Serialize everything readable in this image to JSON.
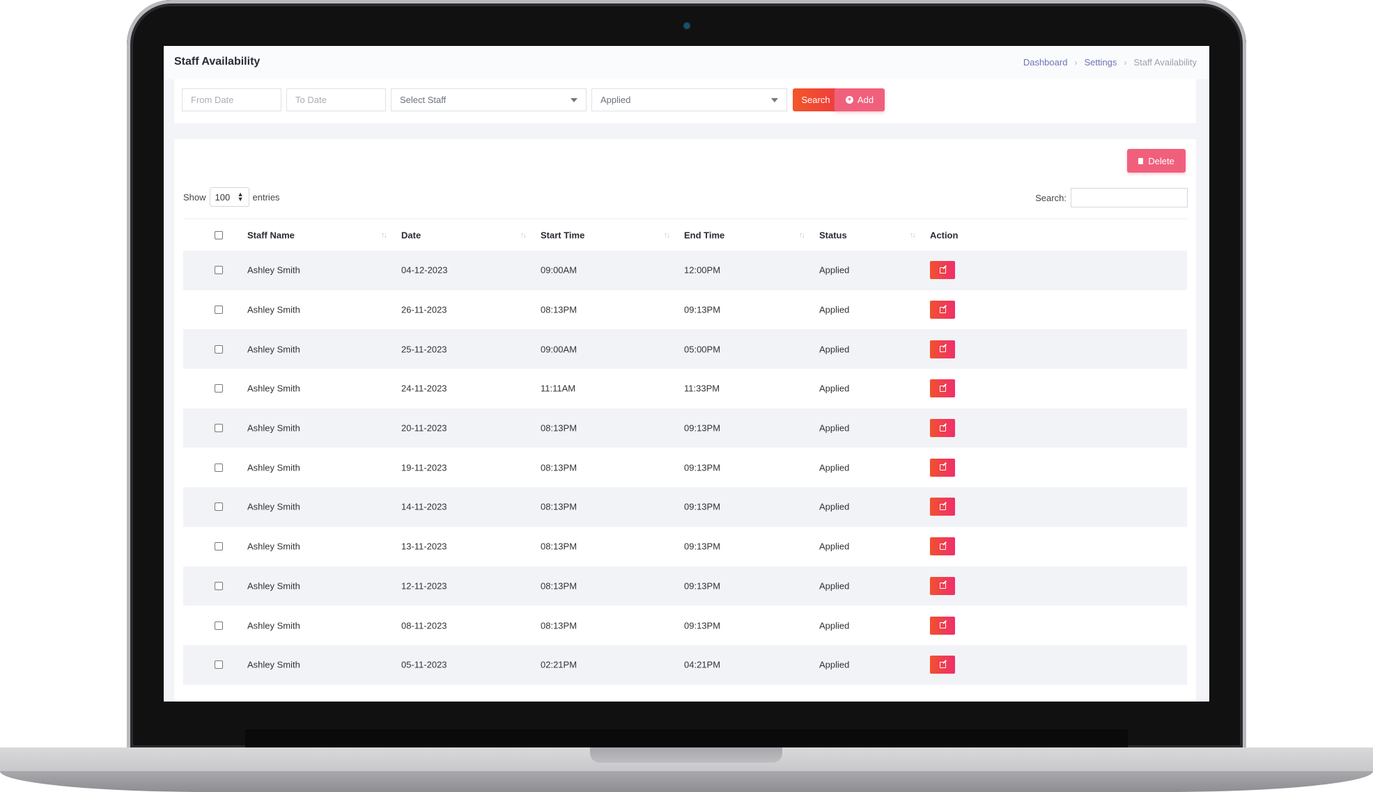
{
  "header": {
    "title": "Staff Availability",
    "breadcrumb": [
      "Dashboard",
      "Settings",
      "Staff Availability"
    ]
  },
  "filters": {
    "from_date_placeholder": "From Date",
    "to_date_placeholder": "To Date",
    "staff_select": "Select Staff",
    "status_select": "Applied",
    "search_label": "Search",
    "add_label": "Add"
  },
  "toolbar": {
    "delete_label": "Delete",
    "show_label": "Show",
    "entries_value": "100",
    "entries_label": "entries",
    "search_label": "Search:"
  },
  "table": {
    "columns": [
      "Staff Name",
      "Date",
      "Start Time",
      "End Time",
      "Status",
      "Action"
    ],
    "rows": [
      {
        "name": "Ashley Smith",
        "date": "04-12-2023",
        "start": "09:00AM",
        "end": "12:00PM",
        "status": "Applied"
      },
      {
        "name": "Ashley Smith",
        "date": "26-11-2023",
        "start": "08:13PM",
        "end": "09:13PM",
        "status": "Applied"
      },
      {
        "name": "Ashley Smith",
        "date": "25-11-2023",
        "start": "09:00AM",
        "end": "05:00PM",
        "status": "Applied"
      },
      {
        "name": "Ashley Smith",
        "date": "24-11-2023",
        "start": "11:11AM",
        "end": "11:33PM",
        "status": "Applied"
      },
      {
        "name": "Ashley Smith",
        "date": "20-11-2023",
        "start": "08:13PM",
        "end": "09:13PM",
        "status": "Applied"
      },
      {
        "name": "Ashley Smith",
        "date": "19-11-2023",
        "start": "08:13PM",
        "end": "09:13PM",
        "status": "Applied"
      },
      {
        "name": "Ashley Smith",
        "date": "14-11-2023",
        "start": "08:13PM",
        "end": "09:13PM",
        "status": "Applied"
      },
      {
        "name": "Ashley Smith",
        "date": "13-11-2023",
        "start": "08:13PM",
        "end": "09:13PM",
        "status": "Applied"
      },
      {
        "name": "Ashley Smith",
        "date": "12-11-2023",
        "start": "08:13PM",
        "end": "09:13PM",
        "status": "Applied"
      },
      {
        "name": "Ashley Smith",
        "date": "08-11-2023",
        "start": "08:13PM",
        "end": "09:13PM",
        "status": "Applied"
      },
      {
        "name": "Ashley Smith",
        "date": "05-11-2023",
        "start": "02:21PM",
        "end": "04:21PM",
        "status": "Applied"
      }
    ]
  },
  "colors": {
    "accent": "#ef3c3c",
    "pink": "#f0607c",
    "link": "#6b73b8"
  },
  "icons": {
    "add": "plus-circle-icon",
    "delete": "trash-icon",
    "edit": "edit-icon",
    "sort": "sort-icon",
    "dropdown": "chevron-down-icon"
  }
}
